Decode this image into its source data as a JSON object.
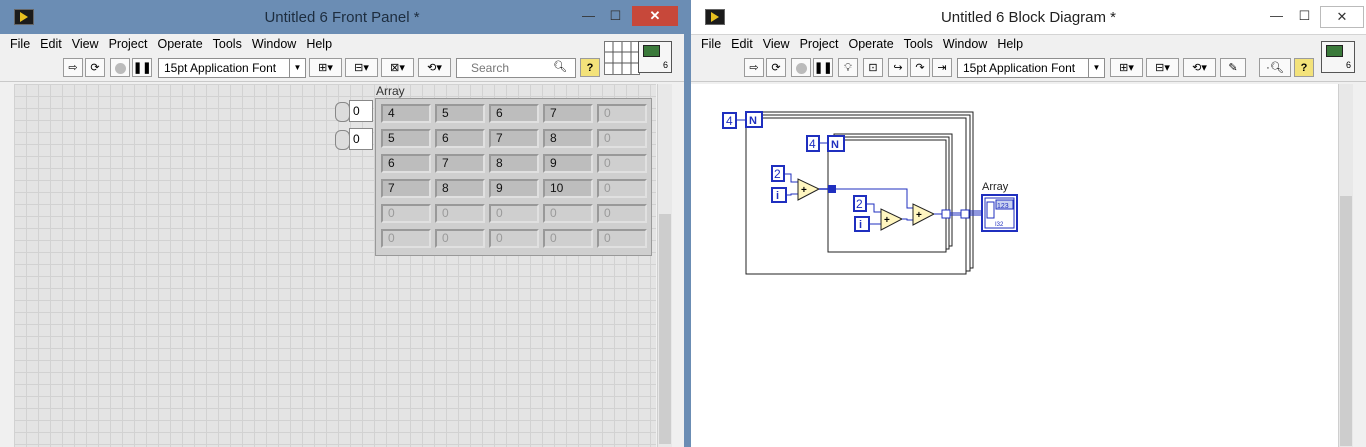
{
  "front_panel": {
    "title": "Untitled 6 Front Panel *",
    "menu": [
      "File",
      "Edit",
      "View",
      "Project",
      "Operate",
      "Tools",
      "Window",
      "Help"
    ],
    "font_select": "15pt Application Font",
    "search_placeholder": "Search",
    "array_label": "Array",
    "index_values": [
      "0",
      "0"
    ],
    "array_rows": [
      [
        "4",
        "5",
        "6",
        "7",
        "0"
      ],
      [
        "5",
        "6",
        "7",
        "8",
        "0"
      ],
      [
        "6",
        "7",
        "8",
        "9",
        "0"
      ],
      [
        "7",
        "8",
        "9",
        "10",
        "0"
      ],
      [
        "0",
        "0",
        "0",
        "0",
        "0"
      ],
      [
        "0",
        "0",
        "0",
        "0",
        "0"
      ]
    ],
    "vi_icon_number": "6"
  },
  "block_diagram": {
    "title": "Untitled 6 Block Diagram *",
    "menu": [
      "File",
      "Edit",
      "View",
      "Project",
      "Operate",
      "Tools",
      "Window",
      "Help"
    ],
    "font_select": "15pt Application Font",
    "outer_loop_count": "4",
    "inner_loop_count": "4",
    "n_terminal": "N",
    "i_terminal": "i",
    "const_outer": "2",
    "const_inner": "2",
    "add_symbol": "+",
    "indicator_label": "Array",
    "indicator_type": "I32",
    "indicator_glyph": "123",
    "vi_icon_number": "6"
  },
  "icons": {
    "run": "run-arrow-icon",
    "run_continuous": "run-continuously-icon",
    "abort": "abort-icon",
    "pause": "pause-icon",
    "highlight": "highlight-execution-icon",
    "search": "magnifier-icon",
    "help": "help-icon"
  },
  "colors": {
    "fp_titlebar": "#6b8db4",
    "close_button": "#c7483a",
    "wire_blue": "#1f2fbf",
    "add_node": "#fff6c0"
  }
}
